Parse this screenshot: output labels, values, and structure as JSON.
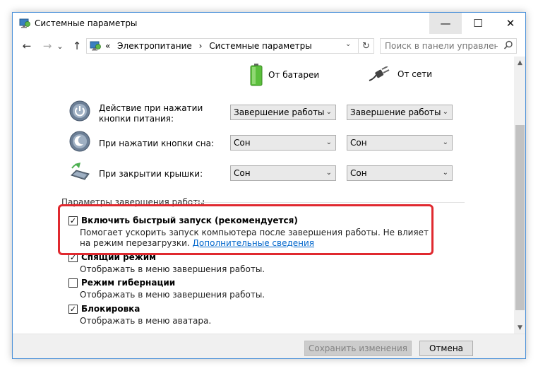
{
  "window": {
    "title": "Системные параметры",
    "minimize_glyph": "—",
    "maximize_glyph": "☐",
    "close_glyph": "✕"
  },
  "nav": {
    "back_glyph": "←",
    "forward_glyph": "→",
    "recent_glyph": "⌄",
    "up_glyph": "↑"
  },
  "address": {
    "prefix": "«",
    "crumbs": [
      "Электропитание",
      "›",
      "Системные параметры"
    ],
    "dropdown_glyph": "⌄",
    "refresh_glyph": "↻"
  },
  "search": {
    "placeholder": "Поиск в панели управления",
    "icon": "search-icon"
  },
  "columns": {
    "battery": "От батареи",
    "plugged": "От сети"
  },
  "settings": [
    {
      "label": "Действие при нажатии кнопки питания:",
      "icon": "power-button-icon",
      "battery": "Завершение работы",
      "plugged": "Завершение работы"
    },
    {
      "label": "При нажатии кнопки сна:",
      "icon": "sleep-button-icon",
      "battery": "Сон",
      "plugged": "Сон"
    },
    {
      "label": "При закрытии крышки:",
      "icon": "laptop-lid-icon",
      "battery": "Сон",
      "plugged": "Сон"
    }
  ],
  "shutdown": {
    "section_title": "Параметры завершения работы",
    "options": [
      {
        "title": "Включить быстрый запуск (рекомендуется)",
        "desc": "Помогает ускорить запуск компьютера после завершения работы. Не влияет на режим перезагрузки.",
        "link": "Дополнительные сведения",
        "checked": true
      },
      {
        "title": "Спящий режим",
        "desc": "Отображать в меню завершения работы.",
        "checked": true
      },
      {
        "title": "Режим гибернации",
        "desc": "Отображать в меню завершения работы.",
        "checked": false
      },
      {
        "title": "Блокировка",
        "desc": "Отображать в меню аватара.",
        "checked": true
      }
    ]
  },
  "footer": {
    "save": "Сохранить изменения",
    "cancel": "Отмена"
  },
  "colors": {
    "highlight": "#e0292f",
    "link": "#0066cc",
    "window_border": "#4a90d9"
  },
  "check_glyph": "✓"
}
